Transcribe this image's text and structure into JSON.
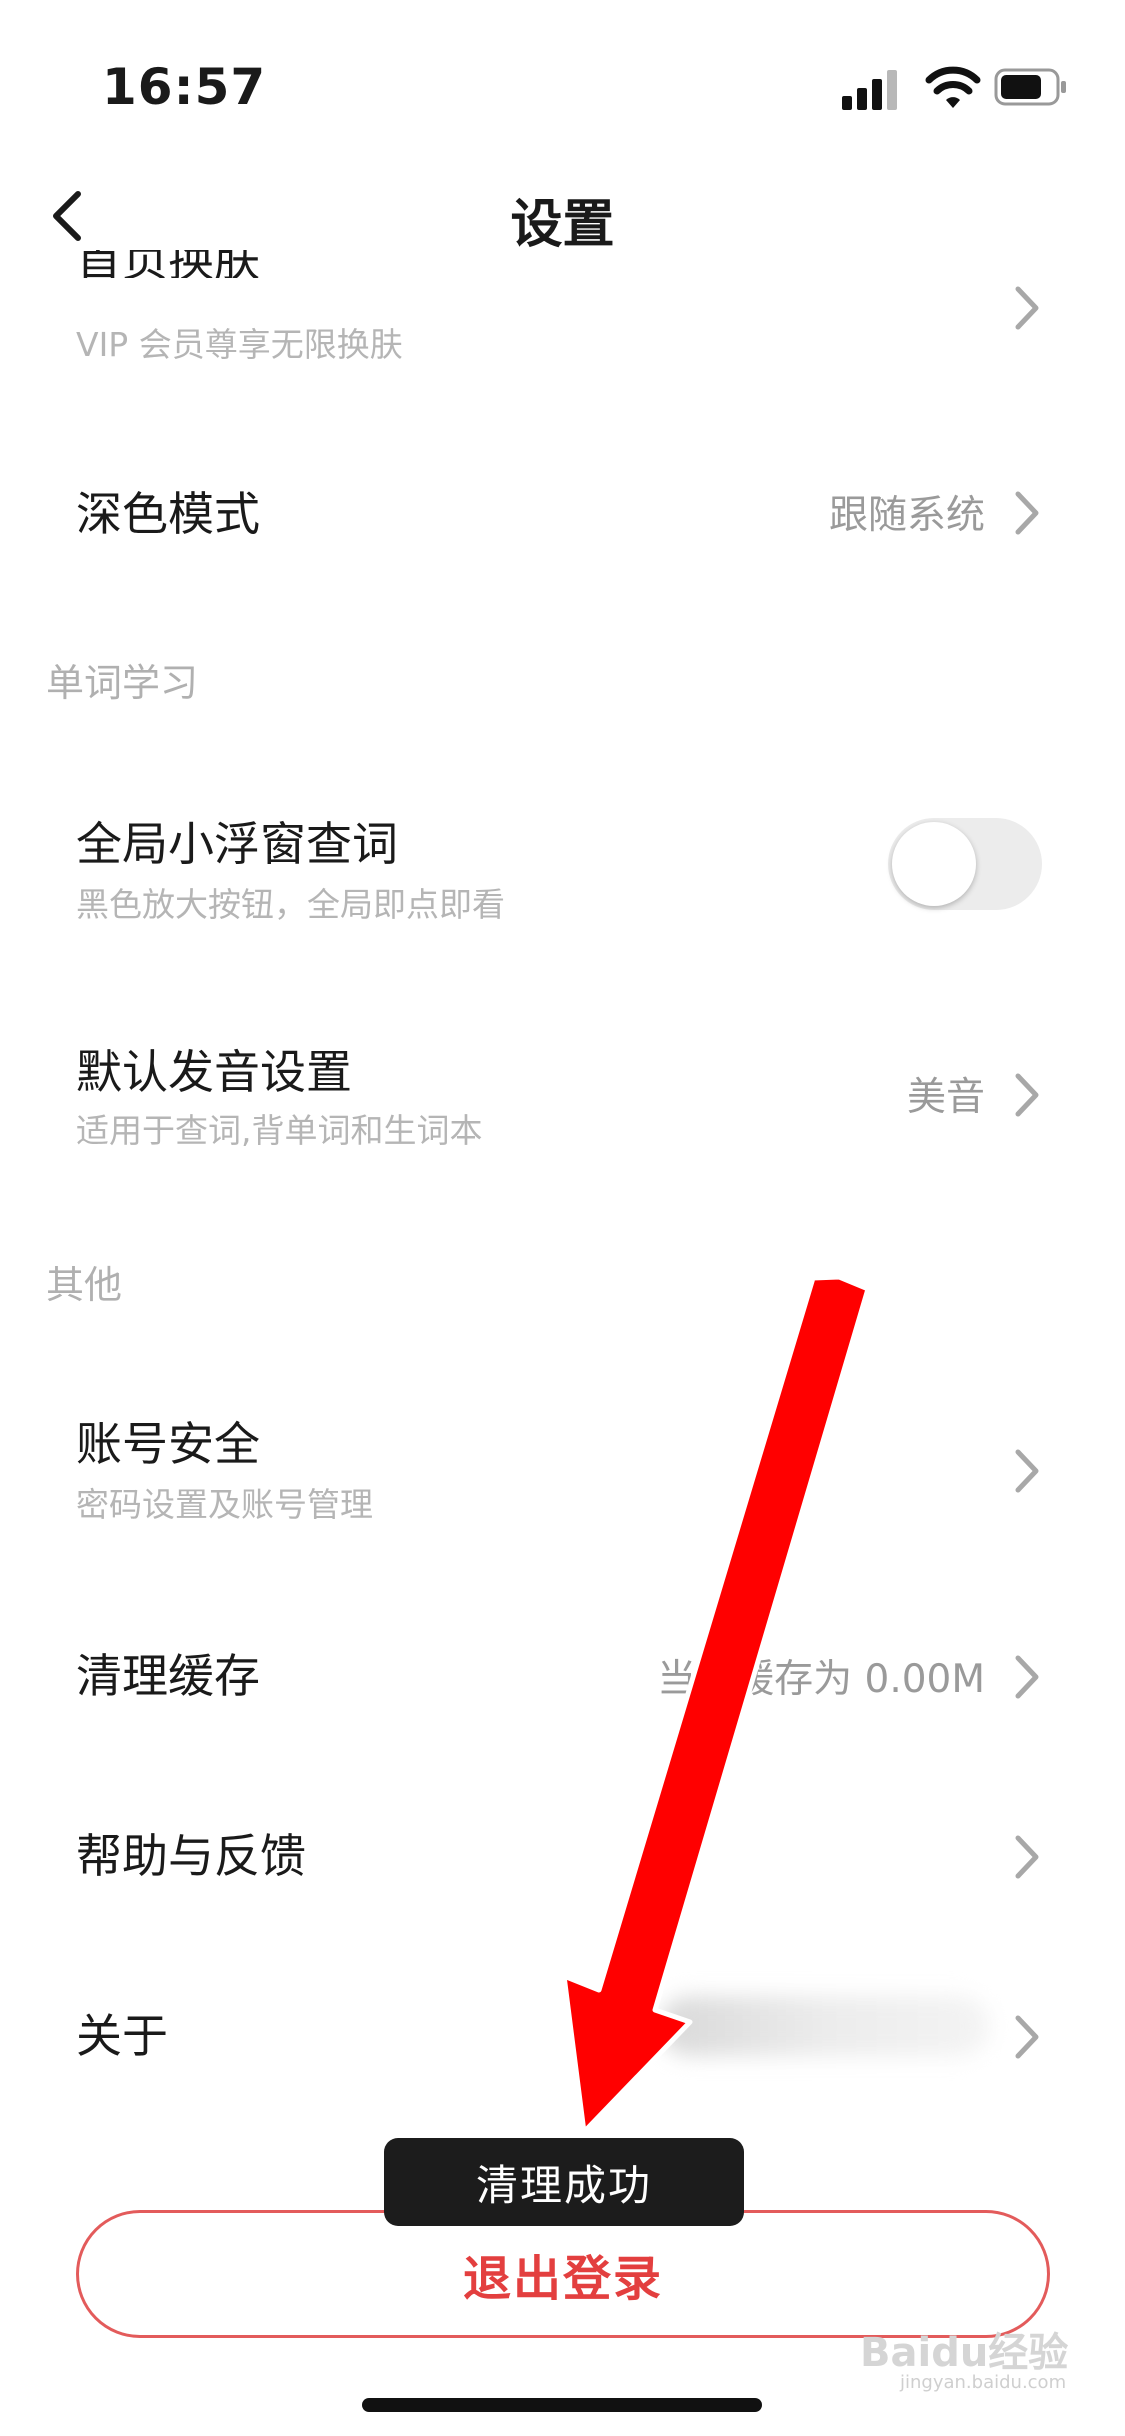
{
  "status_bar": {
    "time": "16:57"
  },
  "nav": {
    "title": "设置"
  },
  "settings": {
    "skin": {
      "title": "首页换肤",
      "subtitle": "VIP 会员尊享无限换肤"
    },
    "dark_mode": {
      "title": "深色模式",
      "value": "跟随系统"
    },
    "section_word_study": "单词学习",
    "floating_window": {
      "title": "全局小浮窗查词",
      "subtitle": "黑色放大按钮，全局即点即看",
      "enabled": false
    },
    "pronunciation": {
      "title": "默认发音设置",
      "subtitle": "适用于查词,背单词和生词本",
      "value": "美音"
    },
    "section_other": "其他",
    "account_security": {
      "title": "账号安全",
      "subtitle": "密码设置及账号管理"
    },
    "clear_cache": {
      "title": "清理缓存",
      "value": "当前缓存为 0.00M"
    },
    "help": {
      "title": "帮助与反馈"
    },
    "about": {
      "title": "关于"
    }
  },
  "toast": {
    "text": "清理成功"
  },
  "logout": {
    "label": "退出登录"
  },
  "watermark": {
    "brand": "Baidu经验",
    "url": "jingyan.baidu.com"
  },
  "colors": {
    "accent_red": "#e33f3f",
    "toast_bg": "#1c1c1c",
    "annotation_arrow": "#ff0000"
  }
}
